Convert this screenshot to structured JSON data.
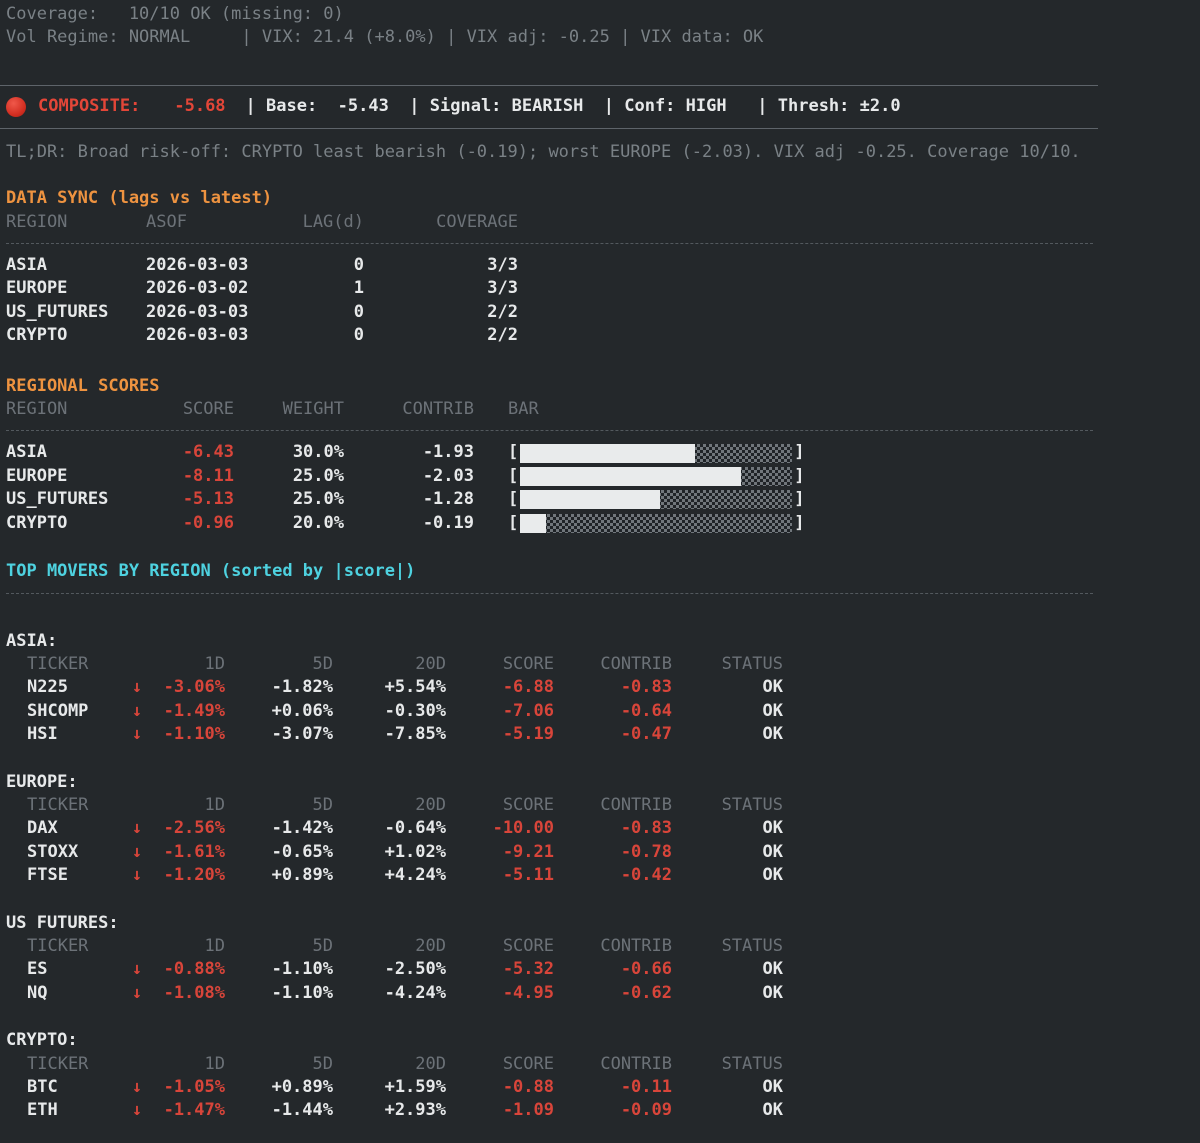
{
  "colors": {
    "accent_orange": "#ee9340",
    "accent_cyan": "#4ed2e0",
    "negative_red": "#d8453a",
    "text_white": "#e7e9ea",
    "dim_gray": "#6c7278",
    "background": "#24282b",
    "bar_fill": "#e9ebec"
  },
  "header": {
    "line1": "Coverage:   10/10 OK (missing: 0)",
    "line2": "Vol Regime: NORMAL     | VIX: 21.4 (+8.0%) | VIX adj: -0.25 | VIX data: OK"
  },
  "composite": {
    "icon": "red-circle",
    "label": "COMPOSITE:",
    "value": "-5.68",
    "rest": "| Base:  -5.43  | Signal: BEARISH  | Conf: HIGH   | Thresh: ±2.0"
  },
  "tldr": "TL;DR: Broad risk-off: CRYPTO least bearish (-0.19); worst EUROPE (-2.03). VIX adj -0.25. Coverage 10/10.",
  "data_sync": {
    "title": "DATA SYNC (lags vs latest)",
    "columns": [
      "REGION",
      "ASOF",
      "LAG(d)",
      "COVERAGE"
    ],
    "rows": [
      {
        "region": "ASIA",
        "asof": "2026-03-03",
        "lag": "0",
        "coverage": "3/3"
      },
      {
        "region": "EUROPE",
        "asof": "2026-03-02",
        "lag": "1",
        "coverage": "3/3"
      },
      {
        "region": "US_FUTURES",
        "asof": "2026-03-03",
        "lag": "0",
        "coverage": "2/2"
      },
      {
        "region": "CRYPTO",
        "asof": "2026-03-03",
        "lag": "0",
        "coverage": "2/2"
      }
    ]
  },
  "regional_scores": {
    "title": "REGIONAL SCORES",
    "columns": [
      "REGION",
      "SCORE",
      "WEIGHT",
      "CONTRIB",
      "BAR"
    ],
    "bar_open": "[",
    "bar_close": "]",
    "rows": [
      {
        "region": "ASIA",
        "score": "-6.43",
        "weight": "30.0%",
        "contrib": "-1.93",
        "bar_pct": 64.3
      },
      {
        "region": "EUROPE",
        "score": "-8.11",
        "weight": "25.0%",
        "contrib": "-2.03",
        "bar_pct": 81.1
      },
      {
        "region": "US_FUTURES",
        "score": "-5.13",
        "weight": "25.0%",
        "contrib": "-1.28",
        "bar_pct": 51.3
      },
      {
        "region": "CRYPTO",
        "score": "-0.96",
        "weight": "20.0%",
        "contrib": "-0.19",
        "bar_pct": 9.6
      }
    ]
  },
  "top_movers": {
    "title": "TOP MOVERS BY REGION (sorted by |score|)",
    "columns": [
      "TICKER",
      "1D",
      "5D",
      "20D",
      "SCORE",
      "CONTRIB",
      "STATUS"
    ],
    "regions": [
      {
        "name": "ASIA:",
        "rows": [
          {
            "ticker": "N225",
            "arrow": "↓",
            "d1": "-3.06%",
            "d5": "-1.82%",
            "d20": "+5.54%",
            "score": "-6.88",
            "contrib": "-0.83",
            "status": "OK"
          },
          {
            "ticker": "SHCOMP",
            "arrow": "↓",
            "d1": "-1.49%",
            "d5": "+0.06%",
            "d20": "-0.30%",
            "score": "-7.06",
            "contrib": "-0.64",
            "status": "OK"
          },
          {
            "ticker": "HSI",
            "arrow": "↓",
            "d1": "-1.10%",
            "d5": "-3.07%",
            "d20": "-7.85%",
            "score": "-5.19",
            "contrib": "-0.47",
            "status": "OK"
          }
        ]
      },
      {
        "name": "EUROPE:",
        "rows": [
          {
            "ticker": "DAX",
            "arrow": "↓",
            "d1": "-2.56%",
            "d5": "-1.42%",
            "d20": "-0.64%",
            "score": "-10.00",
            "contrib": "-0.83",
            "status": "OK"
          },
          {
            "ticker": "STOXX",
            "arrow": "↓",
            "d1": "-1.61%",
            "d5": "-0.65%",
            "d20": "+1.02%",
            "score": "-9.21",
            "contrib": "-0.78",
            "status": "OK"
          },
          {
            "ticker": "FTSE",
            "arrow": "↓",
            "d1": "-1.20%",
            "d5": "+0.89%",
            "d20": "+4.24%",
            "score": "-5.11",
            "contrib": "-0.42",
            "status": "OK"
          }
        ]
      },
      {
        "name": "US FUTURES:",
        "rows": [
          {
            "ticker": "ES",
            "arrow": "↓",
            "d1": "-0.88%",
            "d5": "-1.10%",
            "d20": "-2.50%",
            "score": "-5.32",
            "contrib": "-0.66",
            "status": "OK"
          },
          {
            "ticker": "NQ",
            "arrow": "↓",
            "d1": "-1.08%",
            "d5": "-1.10%",
            "d20": "-4.24%",
            "score": "-4.95",
            "contrib": "-0.62",
            "status": "OK"
          }
        ]
      },
      {
        "name": "CRYPTO:",
        "rows": [
          {
            "ticker": "BTC",
            "arrow": "↓",
            "d1": "-1.05%",
            "d5": "+0.89%",
            "d20": "+1.59%",
            "score": "-0.88",
            "contrib": "-0.11",
            "status": "OK"
          },
          {
            "ticker": "ETH",
            "arrow": "↓",
            "d1": "-1.47%",
            "d5": "-1.44%",
            "d20": "+2.93%",
            "score": "-1.09",
            "contrib": "-0.09",
            "status": "OK"
          }
        ]
      }
    ]
  }
}
